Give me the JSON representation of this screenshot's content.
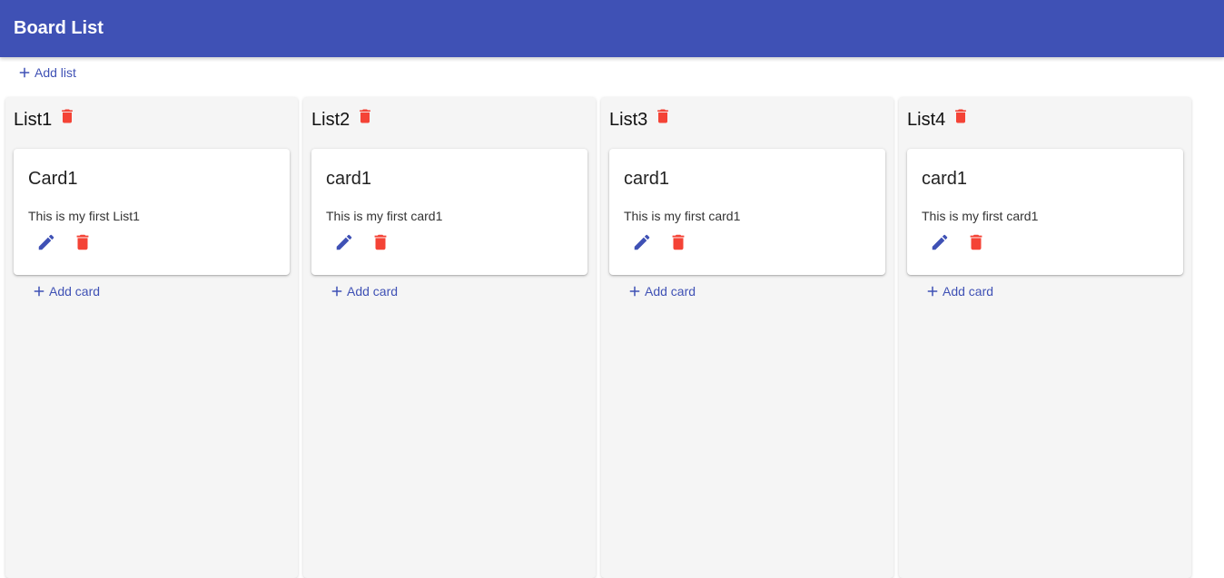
{
  "header": {
    "title": "Board List"
  },
  "toolbar": {
    "add_list_label": "Add list",
    "add_icon": "plus-icon"
  },
  "colors": {
    "primary": "#3f51b5",
    "danger": "#f44336",
    "column_bg": "#f5f5f5"
  },
  "lists": [
    {
      "title": "List1",
      "card": {
        "title": "Card1",
        "text": "This is my first List1"
      },
      "add_card_label": "Add card"
    },
    {
      "title": "List2",
      "card": {
        "title": "card1",
        "text": "This is my first card1"
      },
      "add_card_label": "Add card"
    },
    {
      "title": "List3",
      "card": {
        "title": "card1",
        "text": "This is my first card1"
      },
      "add_card_label": "Add card"
    },
    {
      "title": "List4",
      "card": {
        "title": "card1",
        "text": "This is my first card1"
      },
      "add_card_label": "Add card"
    }
  ]
}
